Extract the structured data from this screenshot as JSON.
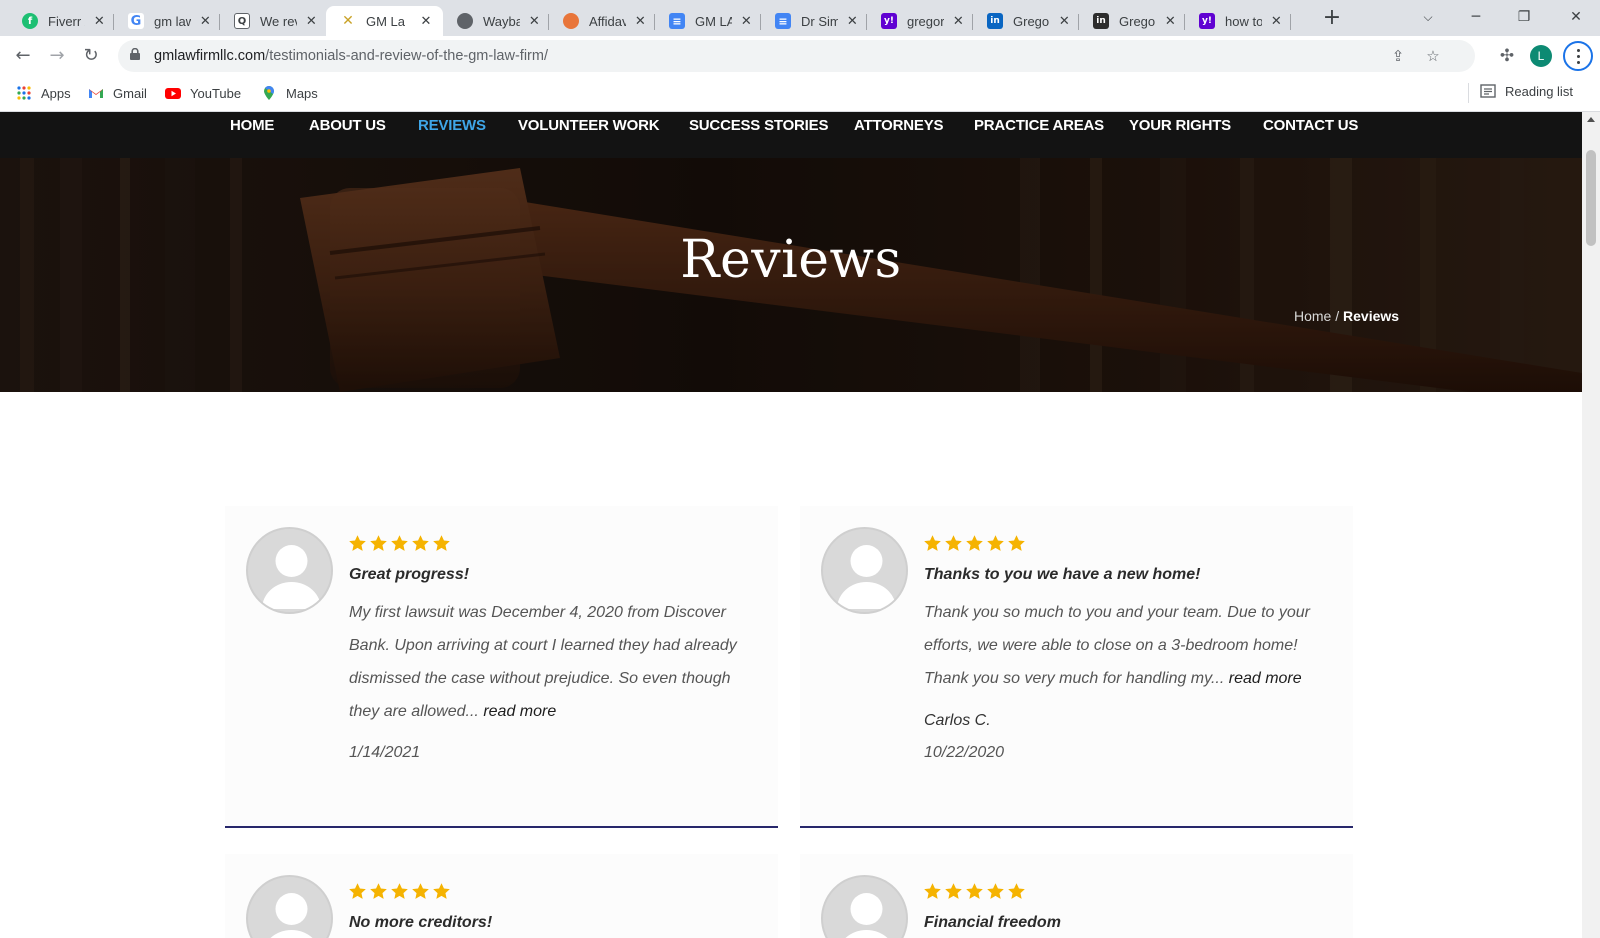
{
  "browser": {
    "tabs": [
      {
        "title": "Fiverr / ",
        "favicon": "fiverr-icon",
        "color": "#1dbf73",
        "glyph": "f"
      },
      {
        "title": "gm law",
        "favicon": "google-icon",
        "color": "#4285f4",
        "glyph": "G"
      },
      {
        "title": "We rev",
        "favicon": "review-site-icon",
        "color": "#5f6368",
        "glyph": "Q"
      },
      {
        "title": "GM La",
        "favicon": "gm-law-icon",
        "color": "#c9a227",
        "glyph": "✕"
      },
      {
        "title": "Wayba",
        "favicon": "globe-icon",
        "color": "#5f6368",
        "glyph": "◍"
      },
      {
        "title": "Affidav",
        "favicon": "affidavit-icon",
        "color": "#e8753a",
        "glyph": "◉"
      },
      {
        "title": "GM LA",
        "favicon": "google-docs-icon",
        "color": "#4285f4",
        "glyph": "≡"
      },
      {
        "title": "Dr Sim",
        "favicon": "google-docs-icon",
        "color": "#4285f4",
        "glyph": "≡"
      },
      {
        "title": "gregor",
        "favicon": "yahoo-icon",
        "color": "#6001d2",
        "glyph": "y!"
      },
      {
        "title": "Gregor",
        "favicon": "linkedin-icon",
        "color": "#0a66c2",
        "glyph": "in"
      },
      {
        "title": "Gregor",
        "favicon": "indeed-icon",
        "color": "#2d2d2d",
        "glyph": "in"
      },
      {
        "title": "how to",
        "favicon": "yahoo-icon",
        "color": "#6001d2",
        "glyph": "y!"
      }
    ],
    "url_host": "gmlawfirmllc.com",
    "url_path": "/testimonials-and-review-of-the-gm-law-firm/",
    "profile_initial": "L",
    "bookmarks": [
      {
        "label": "Apps",
        "icon": "apps-grid-icon"
      },
      {
        "label": "Gmail",
        "icon": "gmail-icon"
      },
      {
        "label": "YouTube",
        "icon": "youtube-icon"
      },
      {
        "label": "Maps",
        "icon": "maps-icon"
      }
    ],
    "reading_list": "Reading list"
  },
  "site": {
    "nav": [
      "HOME",
      "ABOUT US",
      "REVIEWS",
      "VOLUNTEER WORK",
      "SUCCESS STORIES",
      "ATTORNEYS",
      "PRACTICE AREAS",
      "YOUR RIGHTS",
      "CONTACT US"
    ],
    "nav_active": "REVIEWS",
    "hero_title": "Reviews",
    "breadcrumb_home": "Home",
    "breadcrumb_sep": " / ",
    "breadcrumb_current": "Reviews"
  },
  "reviews": [
    {
      "rating": 5,
      "title": "Great progress!",
      "excerpt": "My first lawsuit was December 4, 2020 from Discover Bank. Upon arriving at court I learned they had already dismissed the case without prejudice. So even though they are allowed...",
      "more": "read more",
      "author": "",
      "date": "1/14/2021"
    },
    {
      "rating": 5,
      "title": "Thanks to you we have a new home!",
      "excerpt": "Thank you so much to you and your team. Due to your efforts, we were able to close on a 3-bedroom home! Thank you so very much for handling my...",
      "more": "read more",
      "author": "Carlos C.",
      "date": "10/22/2020"
    },
    {
      "rating": 5,
      "title": "No more creditors!"
    },
    {
      "rating": 5,
      "title": "Financial freedom"
    }
  ],
  "colors": {
    "nav_bg": "#131313",
    "nav_active": "#3fa6e8",
    "star": "#f5b301",
    "card_rule": "#27276b",
    "avatar_google": "#0d8a73"
  }
}
